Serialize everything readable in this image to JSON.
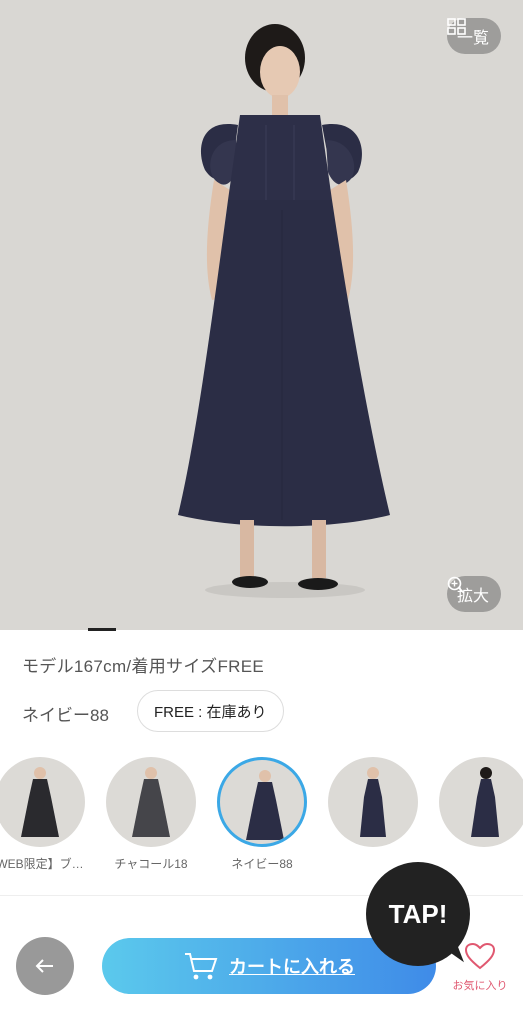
{
  "header": {
    "list_label": "一覧",
    "zoom_label": "拡大"
  },
  "product": {
    "model_info": "モデル167cm/着用サイズFREE",
    "color_name": "ネイビー88",
    "stock": "FREE : 在庫あり"
  },
  "swatches": [
    {
      "label": "WEB限定】ブ…"
    },
    {
      "label": "チャコール18"
    },
    {
      "label": "ネイビー88"
    },
    {
      "label": ""
    },
    {
      "label": ""
    }
  ],
  "actions": {
    "cart_label": "カートに入れる",
    "tap_label": "TAP!",
    "fav_label": "お気に入り"
  },
  "colors": {
    "accent": "#3ba8e6",
    "navy": "#2b2d45",
    "fav": "#e05870"
  }
}
